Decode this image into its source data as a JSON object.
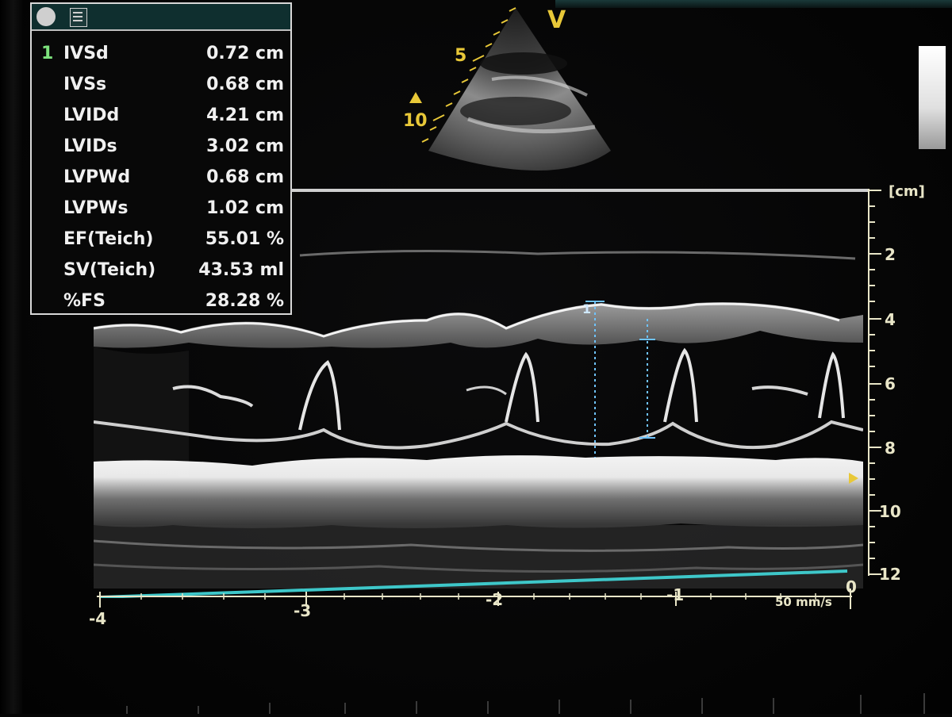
{
  "measurements": {
    "index": "1",
    "rows": [
      {
        "label": "IVSd",
        "value": "0.72 cm"
      },
      {
        "label": "IVSs",
        "value": "0.68 cm"
      },
      {
        "label": "LVIDd",
        "value": "4.21 cm"
      },
      {
        "label": "LVIDs",
        "value": "3.02 cm"
      },
      {
        "label": "LVPWd",
        "value": "0.68 cm"
      },
      {
        "label": "LVPWs",
        "value": "1.02 cm"
      },
      {
        "label": "EF(Teich)",
        "value": "55.01 %"
      },
      {
        "label": "SV(Teich)",
        "value": "43.53 ml"
      },
      {
        "label": "%FS",
        "value": "28.28 %"
      }
    ],
    "icons": [
      "record-circle-icon",
      "report-document-icon"
    ]
  },
  "sector_view": {
    "orientation_marker": "V",
    "depth_labels": [
      "5",
      "10"
    ]
  },
  "depth_axis": {
    "unit": "[cm]",
    "labels": [
      "2",
      "4",
      "6",
      "8",
      "10",
      "12"
    ]
  },
  "time_axis": {
    "labels": [
      "-4",
      "-3",
      "-2",
      "-1",
      "0"
    ],
    "sweep_speed": "50 mm/s"
  },
  "caliper": {
    "marker": "1"
  },
  "colors": {
    "scale_text": "#e9e6c8",
    "marker_yellow": "#e8c838",
    "baseline_cyan": "#3ec7c9",
    "caliper_blue": "#6fc3ff",
    "panel_header": "#0f2f2f",
    "index_green": "#7de27d"
  }
}
